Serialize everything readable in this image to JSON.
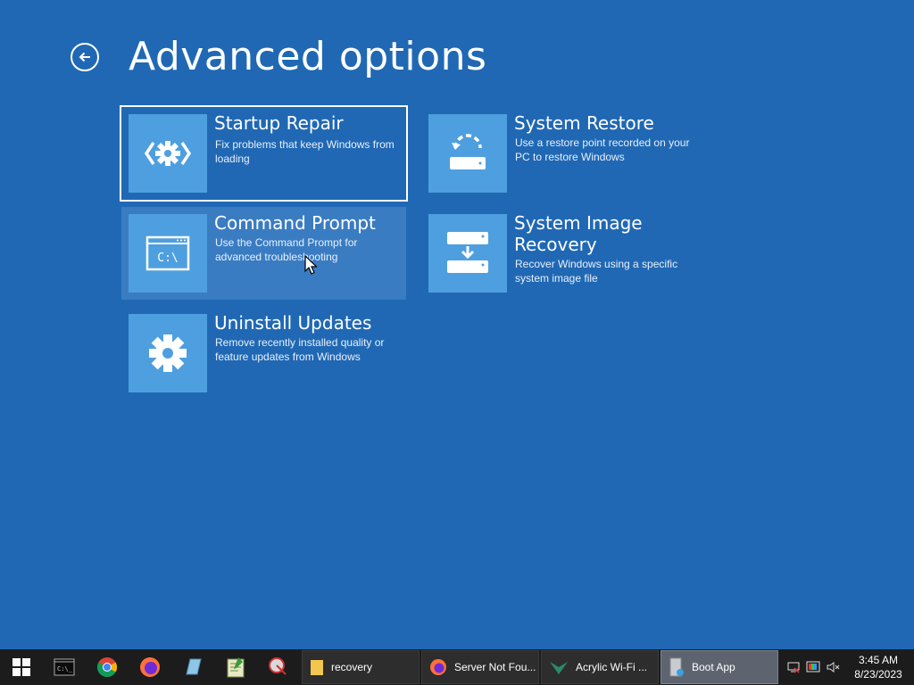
{
  "page": {
    "title": "Advanced options",
    "background": "#2068b4",
    "tile_color": "#4e9fdf"
  },
  "tiles": [
    {
      "title": "Startup Repair",
      "description": "Fix problems that keep Windows from loading",
      "icon": "startup-repair-icon"
    },
    {
      "title": "System Restore",
      "description": "Use a restore point recorded on your PC to restore Windows",
      "icon": "system-restore-icon"
    },
    {
      "title": "Command Prompt",
      "description": "Use the Command Prompt for advanced troubleshooting",
      "icon": "command-prompt-icon"
    },
    {
      "title": "System Image Recovery",
      "description": "Recover Windows using a specific system image file",
      "icon": "system-image-icon"
    },
    {
      "title": "Uninstall Updates",
      "description": "Remove recently installed quality or feature updates from Windows",
      "icon": "gear-icon"
    }
  ],
  "taskbar": {
    "pinned": [
      "start-icon",
      "terminal-icon",
      "chrome-icon",
      "firefox-icon",
      "notepad-icon",
      "editor-icon",
      "snipping-icon"
    ],
    "tasks": [
      {
        "label": "recovery",
        "icon": "folder-icon"
      },
      {
        "label": "Server Not Fou...",
        "icon": "firefox-icon"
      },
      {
        "label": "Acrylic Wi-Fi ...",
        "icon": "acrylic-icon"
      },
      {
        "label": "Boot App",
        "icon": "boot-app-icon"
      }
    ],
    "clock": {
      "time": "3:45 AM",
      "date": "8/23/2023"
    }
  }
}
